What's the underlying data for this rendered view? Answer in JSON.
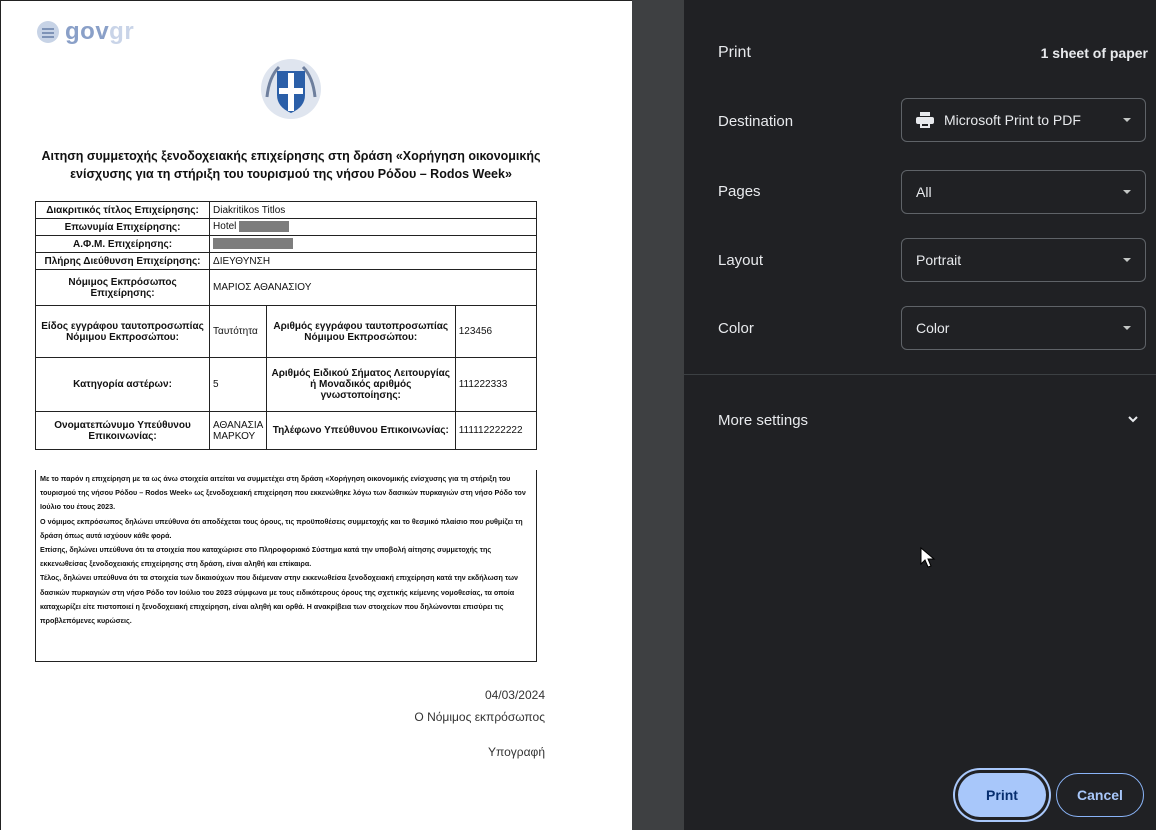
{
  "preview": {
    "logo_text_a": "gov",
    "logo_text_b": "gr",
    "title": "Αιτηση συμμετοχής ξενοδοχειακής επιχείρησης στη δράση «Χορήγηση οικονομικής ενίσχυσης για τη στήριξη του τουρισμού της νήσου Ρόδου – Rodos Week»",
    "rows": [
      {
        "label": "Διακριτικός τίτλος Επιχείρησης:",
        "value": "Diakritikos Titlos"
      },
      {
        "label": "Επωνυμία Επιχείρησης:",
        "value": "Hotel"
      },
      {
        "label": "Α.Φ.Μ. Επιχείρησης:",
        "value": ""
      },
      {
        "label": "Πλήρης Διεύθυνση Επιχείρησης:",
        "value": "ΔΙΕΥΘΥΝΣΗ"
      },
      {
        "label": "Νόμιμος Εκπρόσωπος Επιχείρησης:",
        "value": "ΜΑΡΙΟΣ ΑΘΑΝΑΣΙΟΥ"
      }
    ],
    "pair_rows": [
      {
        "l1": "Είδος εγγράφου ταυτοπροσωπίας Νόμιμου Εκπροσώπου:",
        "v1": "Ταυτότητα",
        "l2": "Αριθμός εγγράφου ταυτοπροσωπίας Νόμιμου Εκπροσώπου:",
        "v2": "123456"
      },
      {
        "l1": "Κατηγορία αστέρων:",
        "v1": "5",
        "l2": "Αριθμός Ειδικού Σήματος Λειτουργίας ή Μοναδικός αριθμός γνωστοποίησης:",
        "v2": "111222333"
      },
      {
        "l1": "Ονοματεπώνυμο Υπεύθυνου Επικοινωνίας:",
        "v1": "ΑΘΑΝΑΣΙΑ ΜΑΡΚΟΥ",
        "l2": "Τηλέφωνο Υπεύθυνου Επικοινωνίας:",
        "v2": "111112222222"
      }
    ],
    "declaration": [
      "Με το παρόν η επιχείρηση με τα ως άνω στοιχεία αιτείται να συμμετέχει στη δράση «Χορήγηση οικονομικής ενίσχυσης για τη στήριξη του τουρισμού της νήσου Ρόδου – Rodos Week» ως ξενοδοχειακή επιχείρηση που εκκενώθηκε λόγω των δασικών πυρκαγιών στη νήσο Ρόδο τον Ιούλιο του έτους 2023.",
      "Ο νόμιμος εκπρόσωπος δηλώνει υπεύθυνα ότι αποδέχεται τους όρους, τις προϋποθέσεις συμμετοχής και το θεσμικό πλαίσιο που ρυθμίζει τη δράση όπως αυτά ισχύουν κάθε φορά.",
      "Επίσης, δηλώνει υπεύθυνα ότι τα στοιχεία που καταχώρισε στο Πληροφοριακό Σύστημα κατά την υποβολή αίτησης συμμετοχής της εκκενωθείσας ξενοδοχειακής επιχείρησης στη δράση, είναι αληθή και επίκαιρα.",
      "Τέλος, δηλώνει υπεύθυνα ότι τα στοιχεία των δικαιούχων που διέμεναν στην εκκενωθείσα ξενοδοχειακή επιχείρηση κατά την εκδήλωση των δασικών πυρκαγιών στη νήσο Ρόδο τον Ιούλιο του 2023 σύμφωνα με τους ειδικότερους όρους της σχετικής κείμενης νομοθεσίας, τα οποία καταχωρίζει είτε πιστοποιεί η ξενοδοχειακή επιχείρηση, είναι αληθή και ορθά. Η ανακρίβεια των στοιχείων που δηλώνονται επισύρει τις προβλεπόμενες κυρώσεις."
    ],
    "date": "04/03/2024",
    "role": "Ο Νόμιμος εκπρόσωπος",
    "signature": "Υπογραφή"
  },
  "dialog": {
    "title": "Print",
    "sheets": "1 sheet of paper",
    "destination_label": "Destination",
    "destination_value": "Microsoft Print to PDF",
    "pages_label": "Pages",
    "pages_value": "All",
    "layout_label": "Layout",
    "layout_value": "Portrait",
    "color_label": "Color",
    "color_value": "Color",
    "more_settings": "More settings",
    "print_button": "Print",
    "cancel_button": "Cancel"
  },
  "icons": {
    "logo": "govgr-logo-icon",
    "emblem": "greek-emblem-icon",
    "printer": "printer-icon",
    "caret": "dropdown-caret-icon",
    "chevron": "chevron-down-icon",
    "cursor": "mouse-cursor-icon"
  },
  "colors": {
    "dialog_bg": "#202124",
    "accent": "#a8c7fa",
    "outline": "#5f6368"
  }
}
